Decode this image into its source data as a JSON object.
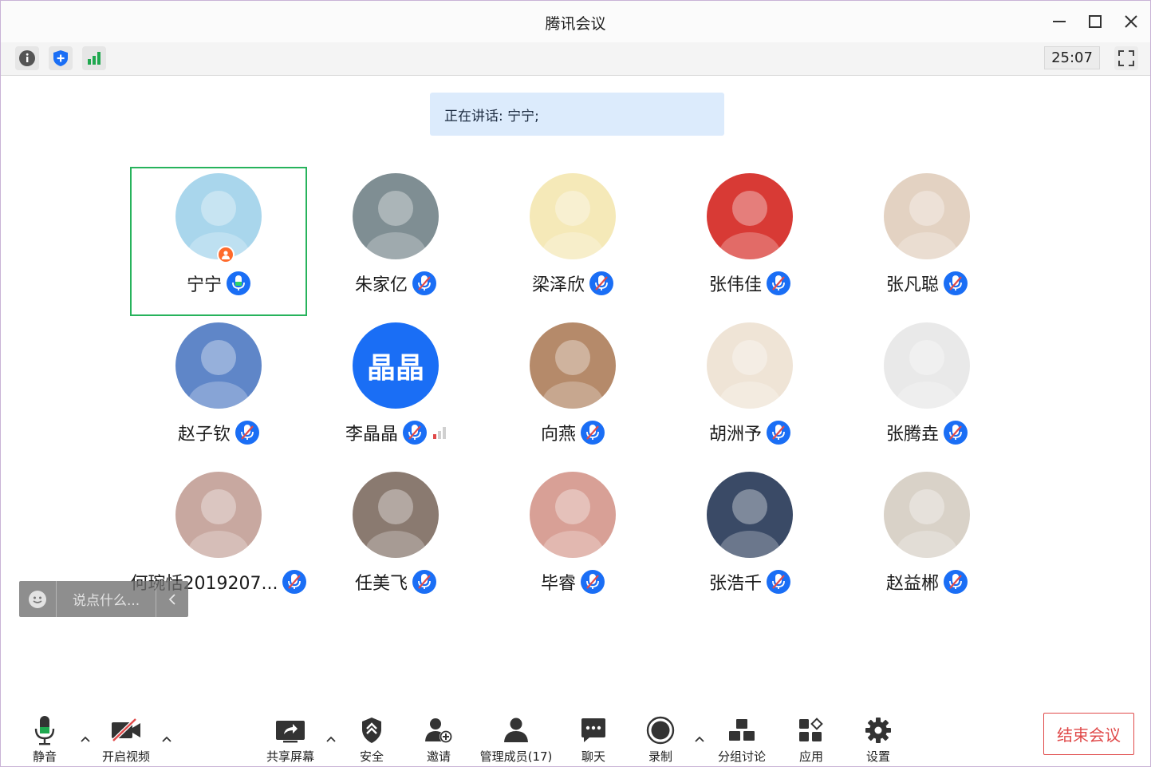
{
  "window": {
    "title": "腾讯会议"
  },
  "toolbar": {
    "timer": "25:07"
  },
  "speaking": {
    "text": "正在讲话: 宁宁;"
  },
  "participants": [
    {
      "name": "宁宁",
      "mic": "on",
      "host": true,
      "active": true,
      "avatar": "girl-cartoon-avatar",
      "avatar_bg": "#a9d6ec"
    },
    {
      "name": "朱家亿",
      "mic": "off",
      "avatar": "cartoon-dog-avatar",
      "avatar_bg": "#7f8e93"
    },
    {
      "name": "梁泽欣",
      "mic": "off",
      "avatar": "cartoon-fox-avatar",
      "avatar_bg": "#f5e9b8"
    },
    {
      "name": "张伟佳",
      "mic": "off",
      "avatar": "new-year-rabbit-avatar",
      "avatar_bg": "#d83a35"
    },
    {
      "name": "张凡聪",
      "mic": "off",
      "avatar": "puppy-photo-avatar",
      "avatar_bg": "#e3d2c2"
    },
    {
      "name": "赵子钦",
      "mic": "off",
      "avatar": "sky-tree-photo-avatar",
      "avatar_bg": "#5f86c8"
    },
    {
      "name": "李晶晶",
      "mic": "off",
      "avatar": "text-avatar",
      "avatar_text": "晶晶",
      "avatar_bg": "#1a6ef5",
      "signal": true
    },
    {
      "name": "向燕",
      "mic": "off",
      "avatar": "smiling-girl-photo-avatar",
      "avatar_bg": "#b58a6a"
    },
    {
      "name": "胡洲予",
      "mic": "off",
      "avatar": "pig-sketch-avatar",
      "avatar_bg": "#efe4d6"
    },
    {
      "name": "张腾垚",
      "mic": "off",
      "avatar": "cartoon-tiger-avatar",
      "avatar_bg": "#e9e9e9"
    },
    {
      "name": "何琬恬2019207...",
      "mic": "off",
      "avatar": "toddler-photo-avatar",
      "avatar_bg": "#c8a8a0"
    },
    {
      "name": "任美飞",
      "mic": "off",
      "avatar": "little-girl-photo-avatar",
      "avatar_bg": "#8a7a70"
    },
    {
      "name": "毕睿",
      "mic": "off",
      "avatar": "closeup-face-photo-avatar",
      "avatar_bg": "#d8a096"
    },
    {
      "name": "张浩千",
      "mic": "off",
      "avatar": "castle-night-photo-avatar",
      "avatar_bg": "#3a4a66"
    },
    {
      "name": "赵益郴",
      "mic": "off",
      "avatar": "man-red-shirt-photo-avatar",
      "avatar_bg": "#d9d2c8"
    }
  ],
  "chat": {
    "placeholder": "说点什么..."
  },
  "bottombar": {
    "mute": "静音",
    "video": "开启视频",
    "share": "共享屏幕",
    "security": "安全",
    "invite": "邀请",
    "members": "管理成员(17)",
    "chat": "聊天",
    "record": "录制",
    "breakout": "分组讨论",
    "apps": "应用",
    "settings": "设置",
    "end": "结束会议"
  },
  "colors": {
    "accent": "#1a6ef5",
    "active_border": "#27b35c",
    "end_red": "#e04a4a",
    "banner_bg": "#dcebfc"
  }
}
